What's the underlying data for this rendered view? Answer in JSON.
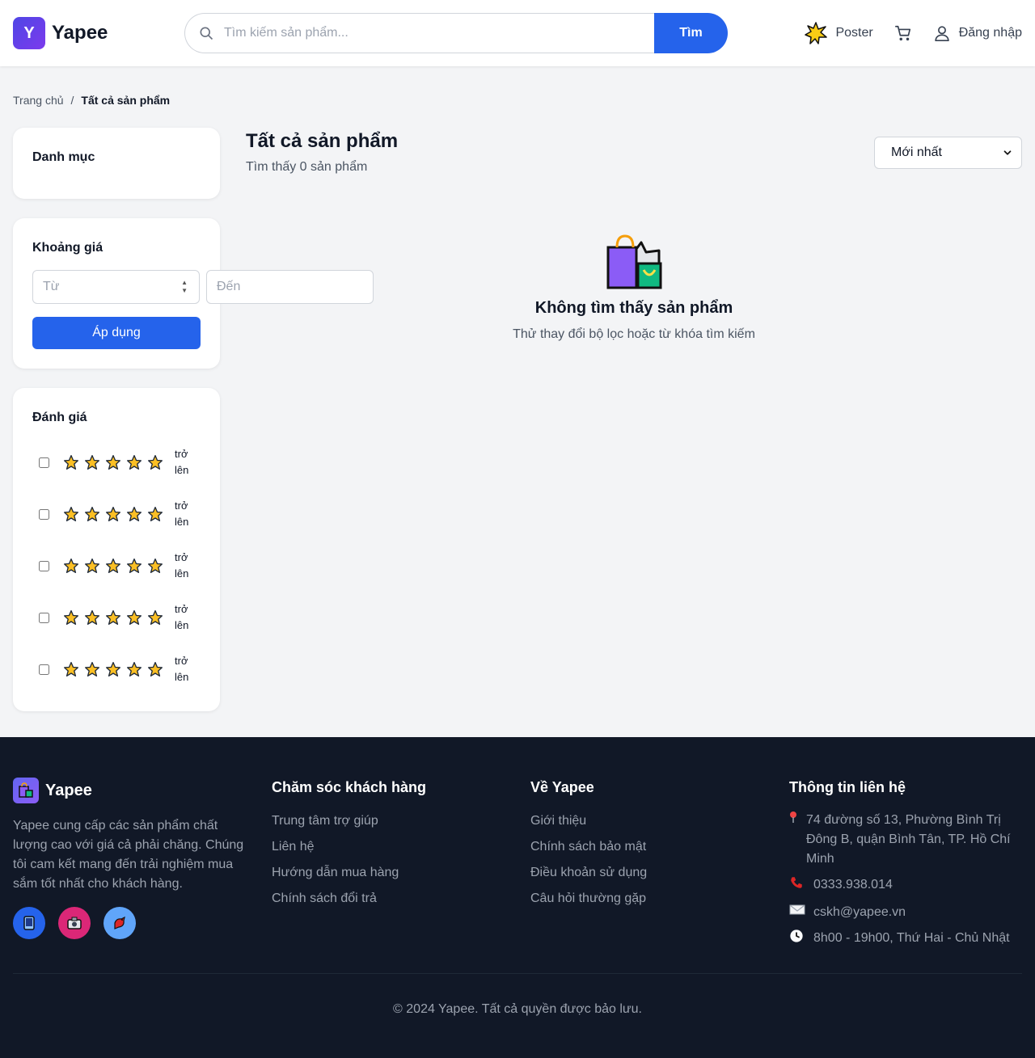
{
  "header": {
    "logo_letter": "Y",
    "brand": "Yapee",
    "search_placeholder": "Tìm kiếm sản phẩm...",
    "search_button": "Tìm",
    "poster_label": "Poster",
    "login_label": "Đăng nhập"
  },
  "breadcrumb": {
    "home": "Trang chủ",
    "separator": "/",
    "current": "Tất cả sản phẩm"
  },
  "sidebar": {
    "category_title": "Danh mục",
    "price": {
      "title": "Khoảng giá",
      "from_placeholder": "Từ",
      "to_placeholder": "Đến",
      "apply_label": "Áp dụng"
    },
    "rating": {
      "title": "Đánh giá",
      "options": [
        {
          "stars": 5,
          "label": "trở lên"
        },
        {
          "stars": 5,
          "label": "trở lên"
        },
        {
          "stars": 5,
          "label": "trở lên"
        },
        {
          "stars": 5,
          "label": "trở lên"
        },
        {
          "stars": 5,
          "label": "trở lên"
        }
      ]
    }
  },
  "main": {
    "title": "Tất cả sản phẩm",
    "count_text": "Tìm thấy 0 sản phẩm",
    "sort_selected": "Mới nhất",
    "empty_title": "Không tìm thấy sản phẩm",
    "empty_subtitle": "Thử thay đổi bộ lọc hoặc từ khóa tìm kiếm"
  },
  "footer": {
    "brand": "Yapee",
    "description": "Yapee cung cấp các sản phẩm chất lượng cao với giá cả phải chăng. Chúng tôi cam kết mang đến trải nghiệm mua sắm tốt nhất cho khách hàng.",
    "socials": [
      {
        "icon": "mobile-phone-icon",
        "color": "#2563eb"
      },
      {
        "icon": "camera-icon",
        "color": "#db2777"
      },
      {
        "icon": "bird-icon",
        "color": "#60a5fa"
      }
    ],
    "customer_care": {
      "title": "Chăm sóc khách hàng",
      "links": [
        "Trung tâm trợ giúp",
        "Liên hệ",
        "Hướng dẫn mua hàng",
        "Chính sách đổi trả"
      ]
    },
    "about": {
      "title": "Về Yapee",
      "links": [
        "Giới thiệu",
        "Chính sách bảo mật",
        "Điều khoản sử dụng",
        "Câu hỏi thường gặp"
      ]
    },
    "contact": {
      "title": "Thông tin liên hệ",
      "address": "74 đường số 13, Phường Bình Trị Đông B, quận Bình Tân, TP. Hồ Chí Minh",
      "phone": "0333.938.014",
      "email": "cskh@yapee.vn",
      "hours": "8h00 - 19h00, Thứ Hai - Chủ Nhật"
    },
    "copyright": "© 2024 Yapee. Tất cả quyền được bảo lưu."
  },
  "colors": {
    "primary": "#2563eb",
    "brand_gradient_start": "#4f46e5",
    "brand_gradient_end": "#7c3aed",
    "footer_bg": "#111827",
    "star": "#fbbf24"
  }
}
